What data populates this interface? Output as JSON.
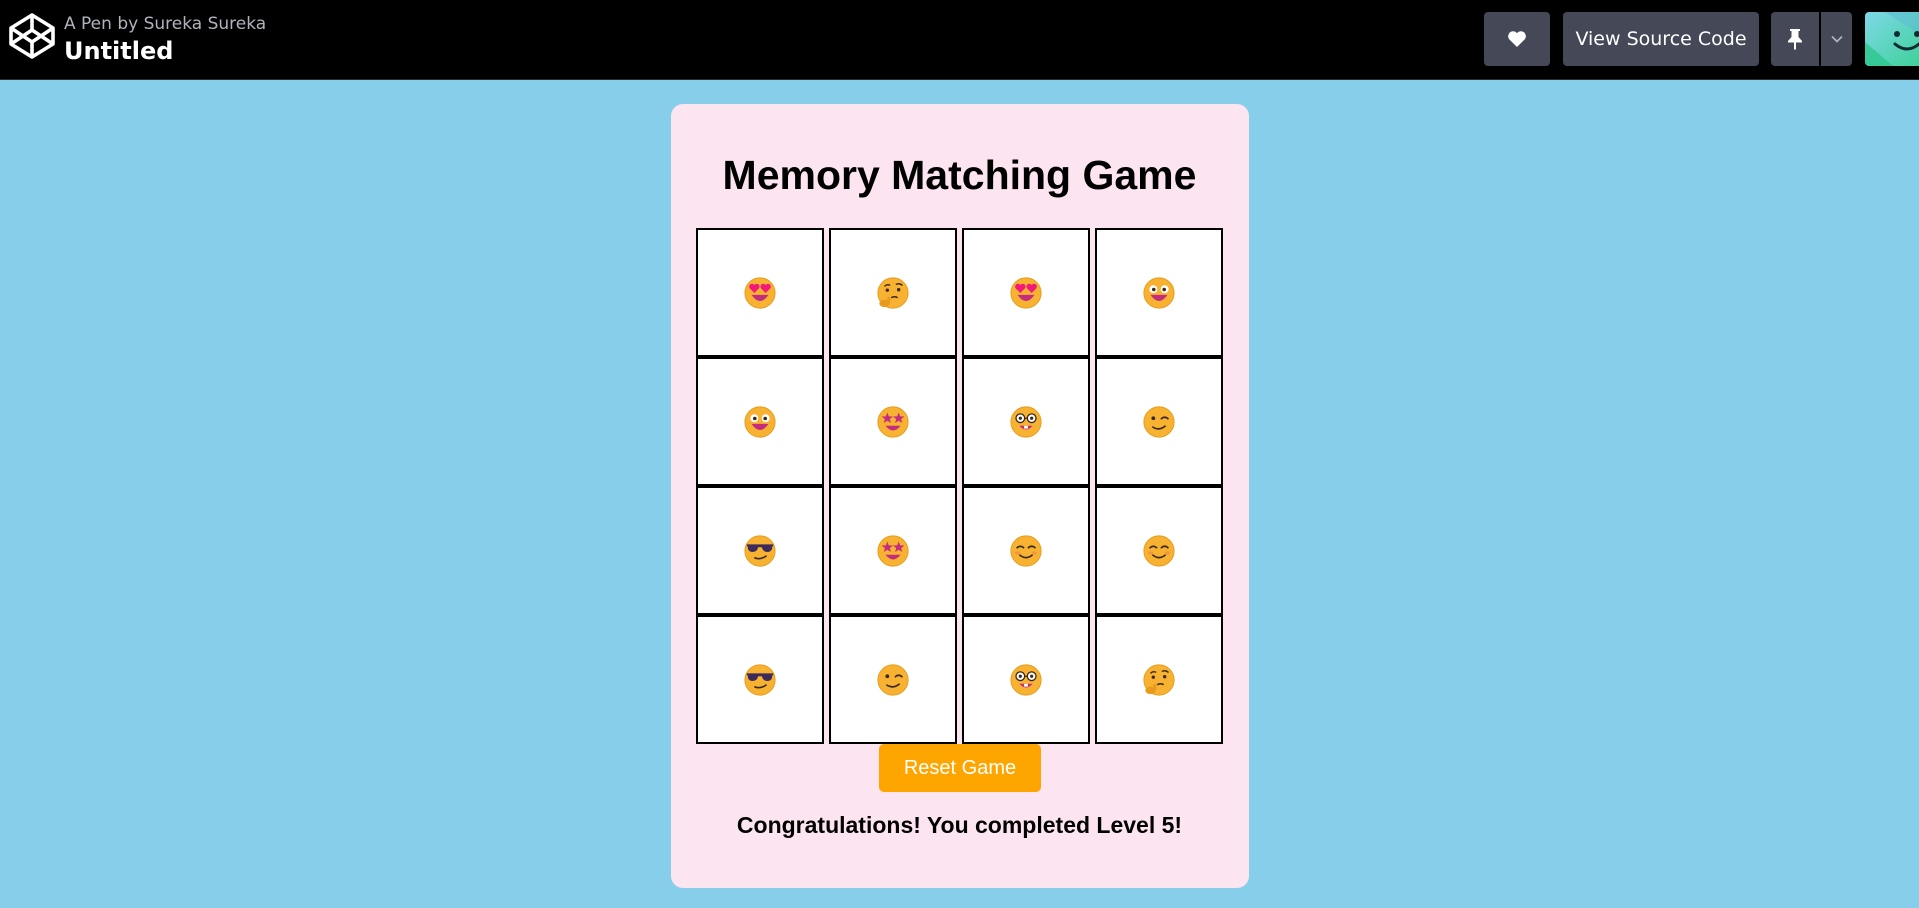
{
  "header": {
    "byline": "A Pen by Sureka Sureka",
    "title": "Untitled",
    "heart_icon": "heart-icon",
    "source_label": "View Source Code",
    "pin_icon": "pin-icon",
    "dropdown_icon": "chevron-down-icon",
    "avatar_icon": "avatar-smiley"
  },
  "game": {
    "title": "Memory Matching Game",
    "cards": [
      [
        "heart-eyes",
        "thinking",
        "heart-eyes",
        "grinning"
      ],
      [
        "grinning",
        "star-struck",
        "nerd",
        "winking"
      ],
      [
        "sunglasses",
        "star-struck",
        "smiling",
        "smiling"
      ],
      [
        "sunglasses",
        "winking",
        "nerd",
        "thinking"
      ]
    ],
    "reset_label": "Reset Game",
    "status": "Congratulations! You completed Level 5!"
  },
  "colors": {
    "page_bg": "#87ceeb",
    "card_bg": "#fde4f1",
    "topbar_bg": "#000000",
    "button_dark": "#444857",
    "reset_bg": "#ffa500",
    "emoji_face": "#f7b232"
  }
}
